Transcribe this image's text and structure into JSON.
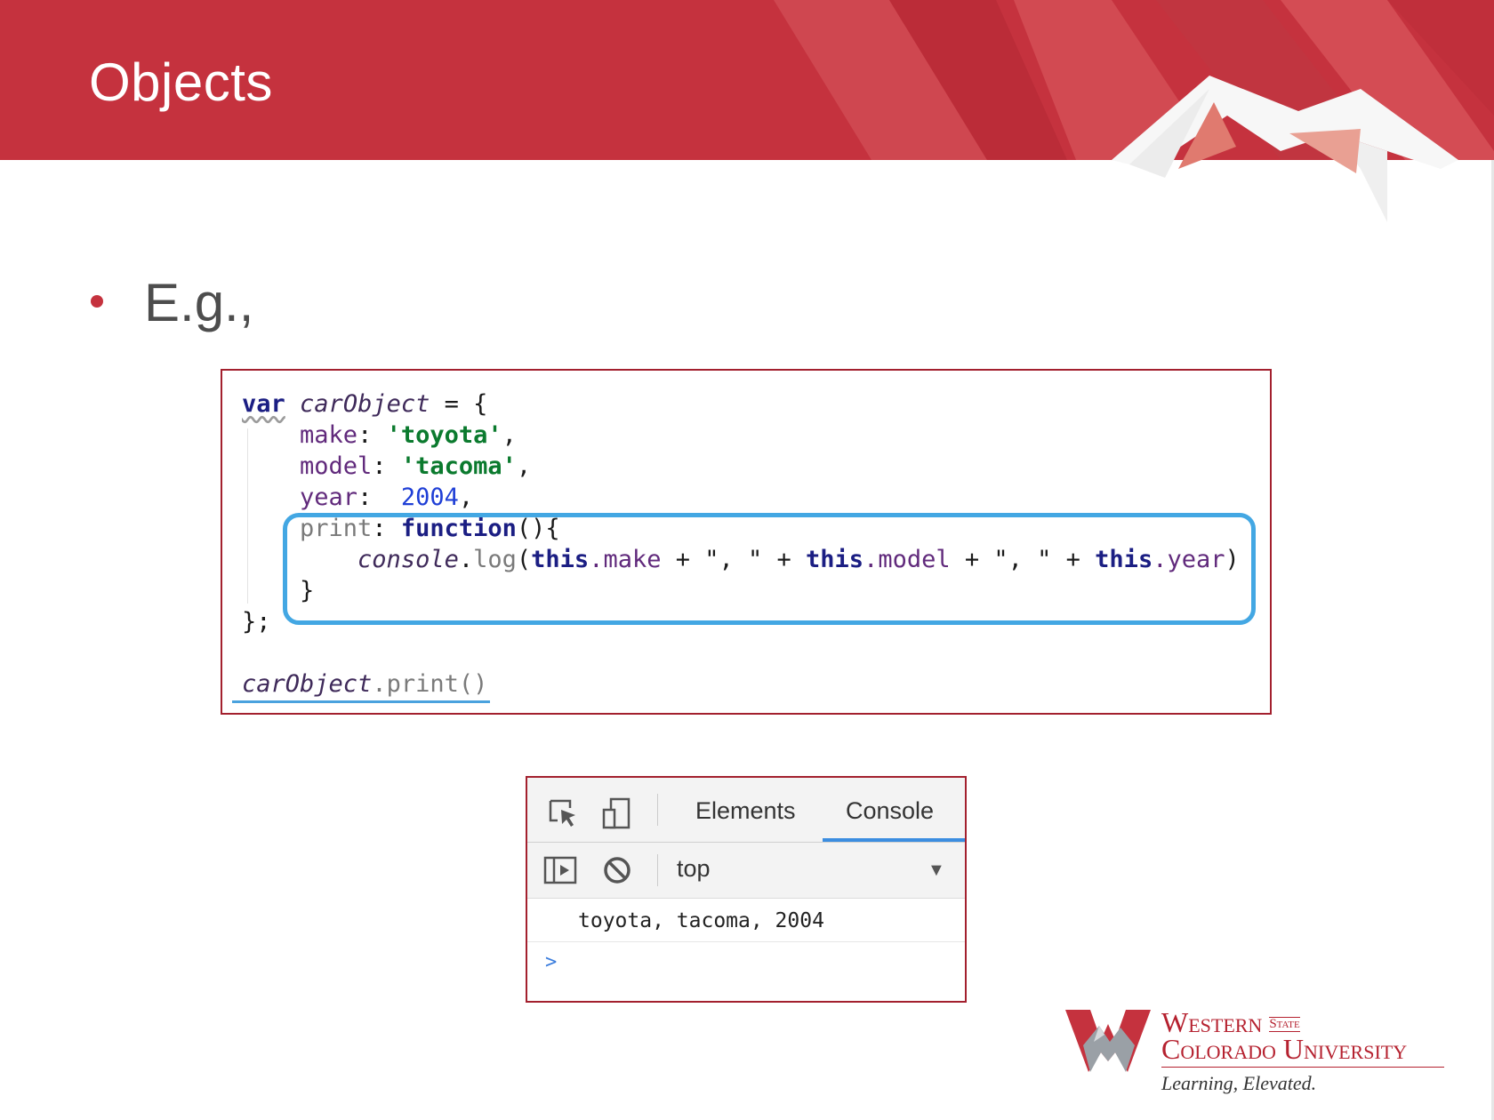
{
  "slide": {
    "title": "Objects",
    "bullet": "E.g.,"
  },
  "code": {
    "l1": {
      "var": "var",
      "name": "carObject",
      "rest": " = {"
    },
    "l2": {
      "key": "make",
      "colon": ": ",
      "val": "'toyota'",
      "end": ","
    },
    "l3": {
      "key": "model",
      "colon": ": ",
      "val": "'tacoma'",
      "end": ","
    },
    "l4": {
      "key": "year",
      "colon": ":  ",
      "val": "2004",
      "end": ","
    },
    "l5": {
      "key": "print",
      "colon": ": ",
      "fn": "function",
      "rest": "(){"
    },
    "l6": {
      "console": "console",
      "dot": ".",
      "log": "log",
      "open": "(",
      "this1": "this",
      "p1": ".make",
      "sep1": " + \", \" + ",
      "this2": "this",
      "p2": ".model",
      "sep2": " + \", \" + ",
      "this3": "this",
      "p3": ".year",
      "close": ")"
    },
    "l7": "}",
    "l8": "};",
    "l9": {
      "name": "carObject",
      "call": ".print()"
    }
  },
  "devtools": {
    "tabs": [
      "Elements",
      "Console"
    ],
    "active_tab": "Console",
    "context": "top",
    "log_output": "toyota, tacoma, 2004",
    "prompt": ">"
  },
  "logo": {
    "line1": "Western",
    "state": "State",
    "line2": "Colorado University",
    "tagline": "Learning, Elevated."
  },
  "colors": {
    "header": "#c5323e",
    "highlight": "#43a7e3",
    "box_border": "#a3202e"
  }
}
